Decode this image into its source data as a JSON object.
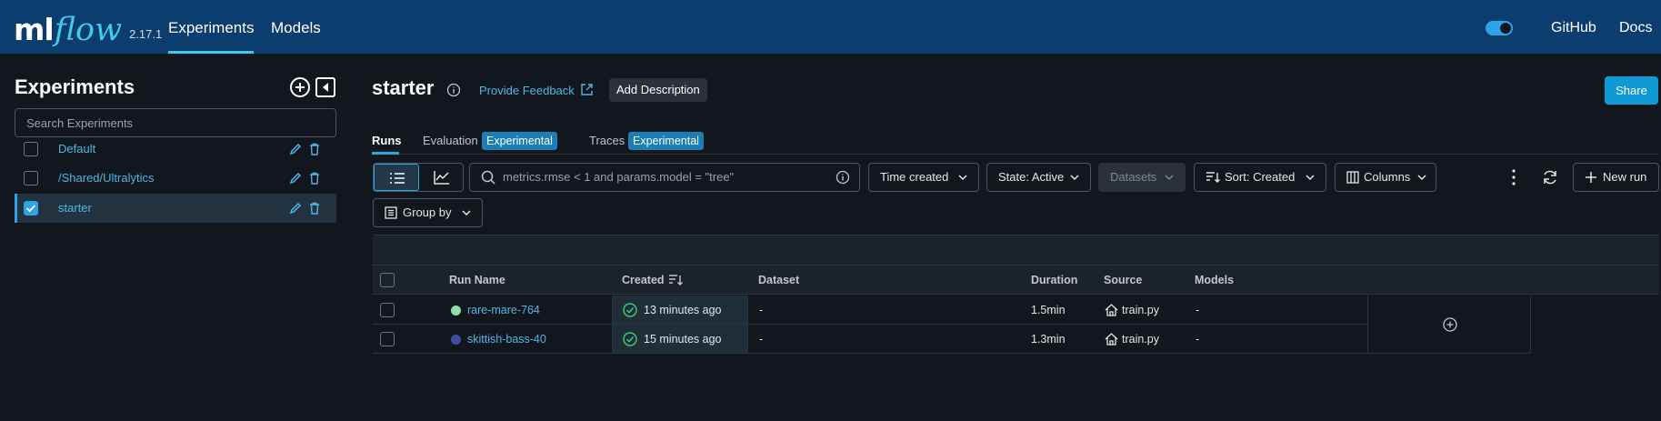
{
  "header": {
    "logo_ml": "ml",
    "logo_flow": "flow",
    "version": "2.17.1",
    "nav": [
      "Experiments",
      "Models"
    ],
    "links": [
      "GitHub",
      "Docs"
    ],
    "theme_toggle_on": true,
    "background_color": "#0b3d6f",
    "accent_color": "#43c9ed"
  },
  "sidebar": {
    "title": "Experiments",
    "search_placeholder": "Search Experiments",
    "experiments": [
      {
        "name": "Default",
        "checked": false
      },
      {
        "name": "/Shared/Ultralytics",
        "checked": false
      },
      {
        "name": "starter",
        "checked": true
      }
    ],
    "icons": [
      "add-circle-icon",
      "collapse-sidebar-icon",
      "pencil-icon",
      "trash-icon"
    ]
  },
  "experiment": {
    "title": "starter",
    "feedback_link": "Provide Feedback",
    "add_description": "Add Description",
    "share": "Share"
  },
  "tabs": [
    {
      "label": "Runs",
      "active": true,
      "badge": ""
    },
    {
      "label": "Evaluation",
      "active": false,
      "badge": "Experimental"
    },
    {
      "label": "Traces",
      "active": false,
      "badge": "Experimental"
    }
  ],
  "controls": {
    "search_placeholder": "metrics.rmse < 1 and params.model = \"tree\"",
    "time_created": "Time created",
    "state": "State: Active",
    "datasets": "Datasets",
    "sort": "Sort: Created",
    "columns": "Columns",
    "new_run": "New run",
    "group_by": "Group by",
    "view_mode": "table"
  },
  "table": {
    "columns": [
      "Run Name",
      "Created",
      "Dataset",
      "Duration",
      "Source",
      "Models"
    ],
    "rows": [
      {
        "run_name": "rare-mare-764",
        "color": "#8fe0a7",
        "created": "13 minutes ago",
        "dataset": "-",
        "duration": "1.5min",
        "source": "train.py",
        "models": "-"
      },
      {
        "run_name": "skittish-bass-40",
        "color": "#3f4fa6",
        "created": "15 minutes ago",
        "dataset": "-",
        "duration": "1.3min",
        "source": "train.py",
        "models": "-"
      }
    ]
  }
}
